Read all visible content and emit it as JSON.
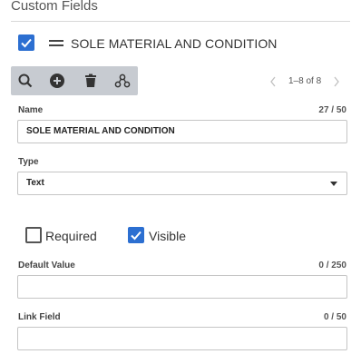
{
  "section": {
    "title": "Custom Fields"
  },
  "field": {
    "enabled": true,
    "heading": "SOLE MATERIAL AND CONDITION"
  },
  "toolbar": {
    "icons": [
      "search-icon",
      "add-circle-icon",
      "trash-icon",
      "hierarchy-icon"
    ],
    "pager_text": "1–8 of 8"
  },
  "form": {
    "name_label": "Name",
    "name_count": "27 / 50",
    "name_value": "SOLE MATERIAL AND CONDITION",
    "type_label": "Type",
    "type_value": "Text",
    "required_label": "Required",
    "required_checked": false,
    "visible_label": "Visible",
    "visible_checked": true,
    "default_label": "Default Value",
    "default_count": "0 / 250",
    "default_value": "",
    "link_label": "Link Field",
    "link_count": "0 / 50",
    "link_value": ""
  },
  "colors": {
    "accent": "#2c6fd1",
    "toolbar_bg": "#c7cbd1"
  }
}
